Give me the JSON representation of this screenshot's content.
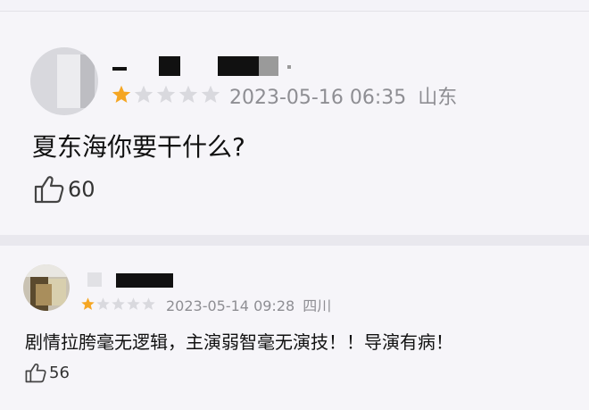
{
  "comments": [
    {
      "rating": 1,
      "max_rating": 5,
      "date": "2023-05-16 06:35",
      "location": "山东",
      "text": "夏东海你要干什么?",
      "likes": "60"
    },
    {
      "rating": 1,
      "max_rating": 5,
      "date": "2023-05-14 09:28",
      "location": "四川",
      "text": "剧情拉胯毫无逻辑，主演弱智毫无演技！！导演有病！",
      "likes": "56"
    }
  ],
  "colors": {
    "star_on": "#f5a623",
    "star_off": "#d9d9de",
    "meta": "#8e8e93"
  },
  "icons": {
    "star": "star-icon",
    "like": "thumbs-up-icon"
  }
}
